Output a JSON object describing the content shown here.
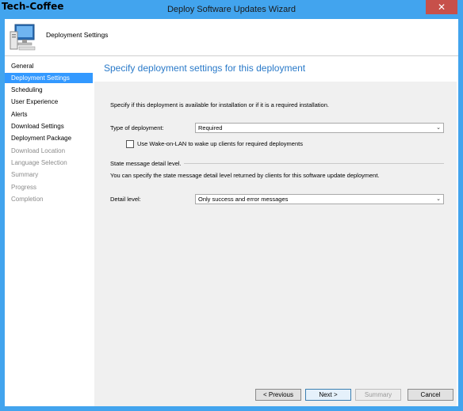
{
  "brand": "Tech-Coffee",
  "window": {
    "title": "Deploy Software Updates Wizard",
    "close_label": "✕"
  },
  "header": {
    "title": "Deployment Settings",
    "icon": "computer-icon"
  },
  "steps": [
    {
      "label": "General",
      "state": "normal"
    },
    {
      "label": "Deployment Settings",
      "state": "active"
    },
    {
      "label": "Scheduling",
      "state": "normal"
    },
    {
      "label": "User Experience",
      "state": "normal"
    },
    {
      "label": "Alerts",
      "state": "normal"
    },
    {
      "label": "Download Settings",
      "state": "normal"
    },
    {
      "label": "Deployment Package",
      "state": "normal"
    },
    {
      "label": "Download Location",
      "state": "disabled"
    },
    {
      "label": "Language Selection",
      "state": "disabled"
    },
    {
      "label": "Summary",
      "state": "disabled"
    },
    {
      "label": "Progress",
      "state": "disabled"
    },
    {
      "label": "Completion",
      "state": "disabled"
    }
  ],
  "main": {
    "heading": "Specify deployment settings for this deployment",
    "intro": "Specify if this deployment is available for installation or if it is a required installation.",
    "type_label": "Type of deployment:",
    "type_value": "Required",
    "wol_label": "Use Wake-on-LAN to wake up clients for required deployments",
    "wol_checked": false,
    "state_heading": "State message detail level.",
    "state_desc": "You can specify the state message detail level returned by clients for this software update deployment.",
    "detail_label": "Detail level:",
    "detail_value": "Only success and error messages"
  },
  "buttons": {
    "previous": "< Previous",
    "next": "Next >",
    "summary": "Summary",
    "cancel": "Cancel"
  },
  "colors": {
    "titlebar": "#42a4ee",
    "active_step": "#3399ff",
    "heading": "#2a7ac9",
    "close": "#c7504a"
  }
}
